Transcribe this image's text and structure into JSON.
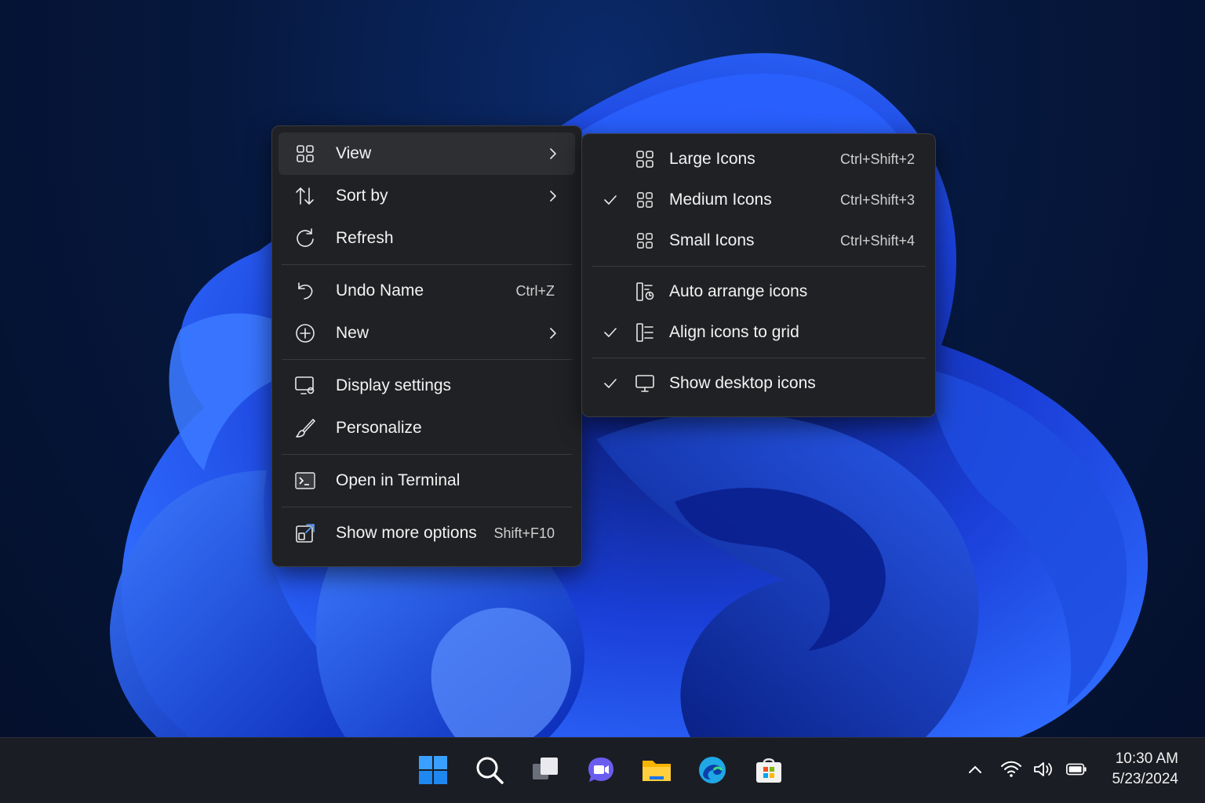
{
  "main_menu": {
    "items": [
      {
        "label": "View",
        "icon": "grid-icon",
        "submenu": true,
        "highlighted": true
      },
      {
        "label": "Sort by",
        "icon": "sort-icon",
        "submenu": true
      },
      {
        "label": "Refresh",
        "icon": "refresh-icon"
      },
      {
        "label": "Undo Name",
        "icon": "undo-icon",
        "shortcut": "Ctrl+Z"
      },
      {
        "label": "New",
        "icon": "plus-circle-icon",
        "submenu": true
      },
      {
        "label": "Display settings",
        "icon": "display-settings-icon"
      },
      {
        "label": "Personalize",
        "icon": "brush-icon"
      },
      {
        "label": "Open in Terminal",
        "icon": "terminal-icon"
      },
      {
        "label": "Show more options",
        "icon": "more-options-icon",
        "shortcut": "Shift+F10"
      }
    ]
  },
  "view_submenu": {
    "items": [
      {
        "label": "Large Icons",
        "icon": "grid-icon",
        "shortcut": "Ctrl+Shift+2",
        "checked": false
      },
      {
        "label": "Medium Icons",
        "icon": "grid-icon",
        "shortcut": "Ctrl+Shift+3",
        "checked": true
      },
      {
        "label": "Small Icons",
        "icon": "grid-icon",
        "shortcut": "Ctrl+Shift+4",
        "checked": false
      },
      {
        "label": "Auto arrange icons",
        "icon": "auto-arrange-icon",
        "checked": false
      },
      {
        "label": "Align icons to grid",
        "icon": "align-grid-icon",
        "checked": true
      },
      {
        "label": "Show desktop icons",
        "icon": "monitor-icon",
        "checked": true
      }
    ]
  },
  "taskbar": {
    "apps": [
      "windows-start-icon",
      "search-icon",
      "task-view-icon",
      "chat-icon",
      "file-explorer-icon",
      "edge-icon",
      "store-icon"
    ],
    "tray": [
      "chevron-up-icon",
      "wifi-icon",
      "volume-icon",
      "battery-icon"
    ],
    "time": "10:30 AM",
    "date": "5/23/2024"
  },
  "colors": {
    "menu_bg": "#202124",
    "highlight": "#2e2f33",
    "accent": "#2f6bff"
  }
}
